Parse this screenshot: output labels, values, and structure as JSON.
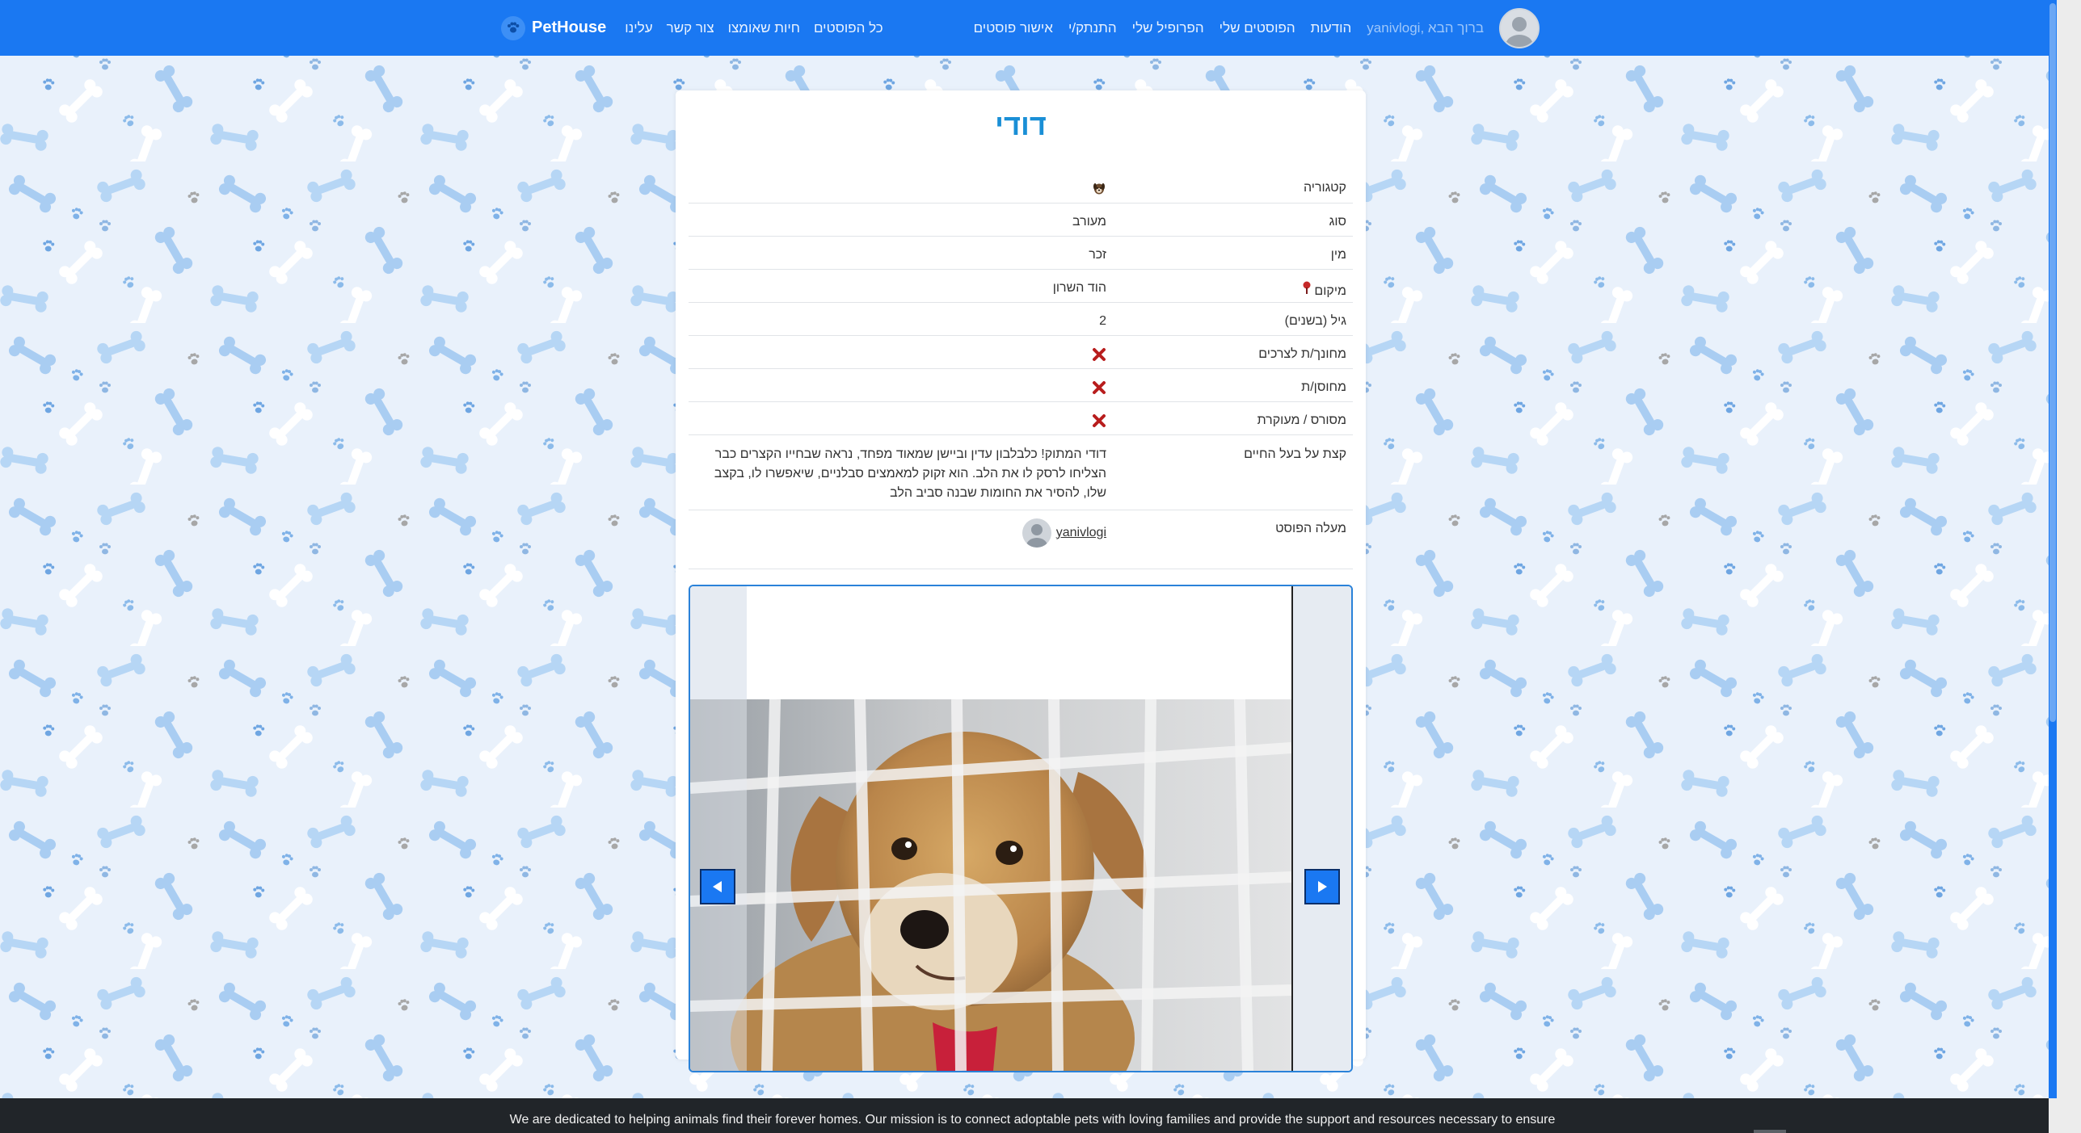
{
  "navbar": {
    "brand": "PetHouse",
    "left_links": [
      "כל הפוסטים",
      "חיות שאומצו",
      "צור קשר",
      "עלינו"
    ],
    "greeting": "yanivlogi, ברוך הבא",
    "right_links": [
      "הודעות",
      "הפוסטים שלי",
      "הפרופיל שלי",
      "התנתק/י",
      "אישור פוסטים"
    ]
  },
  "pet": {
    "name": "דודי",
    "rows": {
      "category_label": "קטגוריה",
      "type_label": "סוג",
      "type_value": "מעורב",
      "gender_label": "מין",
      "gender_value": "זכר",
      "location_label": "מיקום",
      "location_value": "הוד השרון",
      "age_label": "גיל (בשנים)",
      "age_value": "2",
      "trained_label": "מחונך/ת לצרכים",
      "vaccinated_label": "מחוסן/ת",
      "neutered_label": "מסורס / מעוקרת",
      "about_label": "קצת על בעל החיים",
      "about_value": "דודי המתוק! כלבלבון עדין וביישן שמאוד מפחד, נראה שבחייו הקצרים כבר הצליחו לרסק לו את הלב. הוא זקוק למאמצים סבלניים, שיאפשרו לו, בקצב שלו, להסיר את החומות שבנה סביב הלב",
      "uploader_label": "מעלה הפוסט",
      "uploader_name": "yanivlogi"
    },
    "trained": false,
    "vaccinated": false,
    "neutered": false
  },
  "colors": {
    "navbar": "#1a78f2",
    "title": "#1a8fd6",
    "footer": "#212529",
    "x_mark": "#b81d1d"
  },
  "icons": {
    "category": "dog-icon",
    "location": "location-pin-icon",
    "boolean_false": "red-x-icon",
    "prev": "arrow-left-icon",
    "next": "arrow-right-icon"
  },
  "footer": {
    "text": "We are dedicated to helping animals find their forever homes. Our mission is to connect adoptable pets with loving families and provide the support and resources necessary to ensure"
  }
}
